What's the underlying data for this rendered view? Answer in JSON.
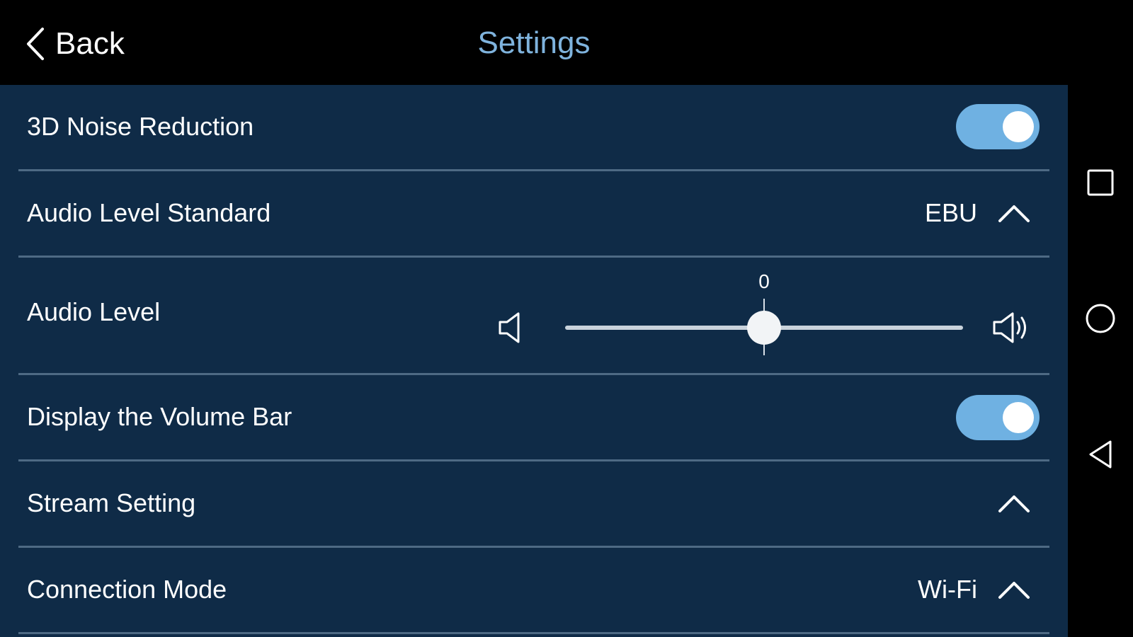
{
  "header": {
    "back_label": "Back",
    "title": "Settings",
    "title_color": "#7fb3dd"
  },
  "settings": {
    "noise_reduction": {
      "label": "3D Noise Reduction",
      "enabled": true
    },
    "audio_level_standard": {
      "label": "Audio Level Standard",
      "value": "EBU",
      "icon": "chevron-up-icon"
    },
    "audio_level": {
      "label": "Audio Level",
      "value": "0",
      "position_fraction": 0.5,
      "low_icon": "speaker-low-icon",
      "high_icon": "speaker-high-icon"
    },
    "display_volume_bar": {
      "label": "Display the Volume Bar",
      "enabled": true
    },
    "stream_setting": {
      "label": "Stream Setting",
      "icon": "chevron-up-icon"
    },
    "connection_mode": {
      "label": "Connection Mode",
      "value": "Wi-Fi",
      "icon": "chevron-up-icon"
    }
  },
  "navbar": {
    "buttons": [
      "recents-square-icon",
      "home-circle-icon",
      "back-triangle-icon"
    ]
  },
  "colors": {
    "panel_bg": "#0f2b47",
    "toggle_on": "#6fb1e2",
    "divider": "#4e6a84"
  }
}
